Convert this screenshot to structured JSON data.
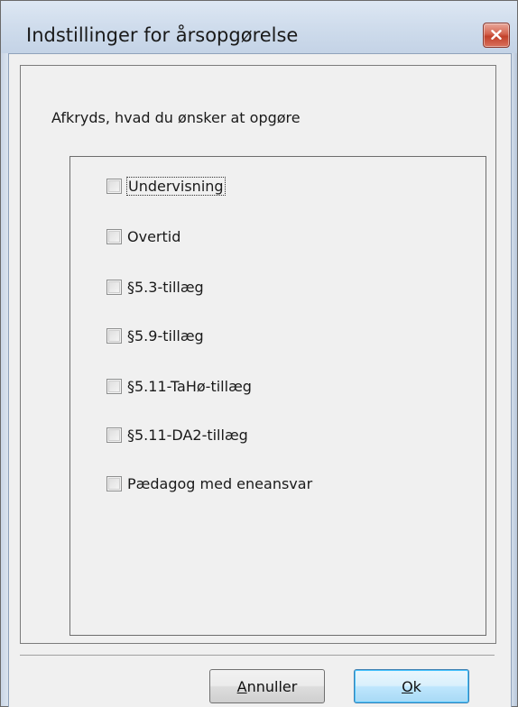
{
  "window": {
    "title": "Indstillinger for årsopgørelse"
  },
  "content": {
    "instruction": "Afkryds, hvad du ønsker at opgøre",
    "options": [
      {
        "label": "Undervisning",
        "checked": false,
        "focused": true
      },
      {
        "label": "Overtid",
        "checked": false,
        "focused": false
      },
      {
        "label": "§5.3-tillæg",
        "checked": false,
        "focused": false
      },
      {
        "label": "§5.9-tillæg",
        "checked": false,
        "focused": false
      },
      {
        "label": "§5.11-TaHø-tillæg",
        "checked": false,
        "focused": false
      },
      {
        "label": "§5.11-DA2-tillæg",
        "checked": false,
        "focused": false
      },
      {
        "label": "Pædagog med eneansvar",
        "checked": false,
        "focused": false
      }
    ]
  },
  "buttons": {
    "cancel": {
      "mnemonic": "A",
      "rest": "nnuller"
    },
    "ok": {
      "mnemonic": "O",
      "rest": "k"
    }
  },
  "colors": {
    "close_button": "#c1412b",
    "ok_button_border": "#3c7fb1",
    "dialog_background": "#f0f0f0"
  },
  "icons": {
    "close": "close-x-icon"
  }
}
